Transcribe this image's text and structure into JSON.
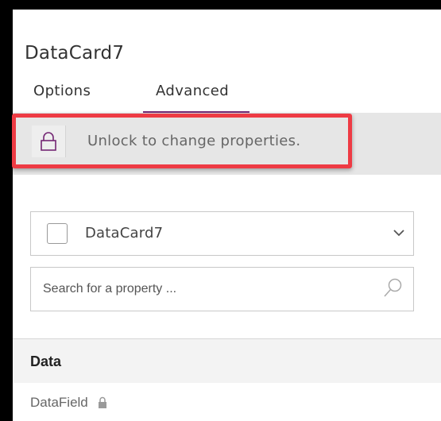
{
  "panel": {
    "title": "DataCard7",
    "tabs": [
      {
        "label": "Options",
        "active": false
      },
      {
        "label": "Advanced",
        "active": true
      }
    ],
    "lock_banner": {
      "icon": "lock-icon",
      "text": "Unlock to change properties."
    },
    "control_selector": {
      "value": "DataCard7",
      "icon": "chevron-down-icon"
    },
    "search": {
      "placeholder": "Search for a property ...",
      "icon": "search-icon"
    },
    "sections": [
      {
        "label": "Data",
        "properties": [
          {
            "label": "DataField",
            "locked": true
          }
        ]
      }
    ]
  },
  "colors": {
    "accent": "#742774",
    "highlight": "#ee3b44",
    "banner_bg": "#e6e6e6"
  }
}
